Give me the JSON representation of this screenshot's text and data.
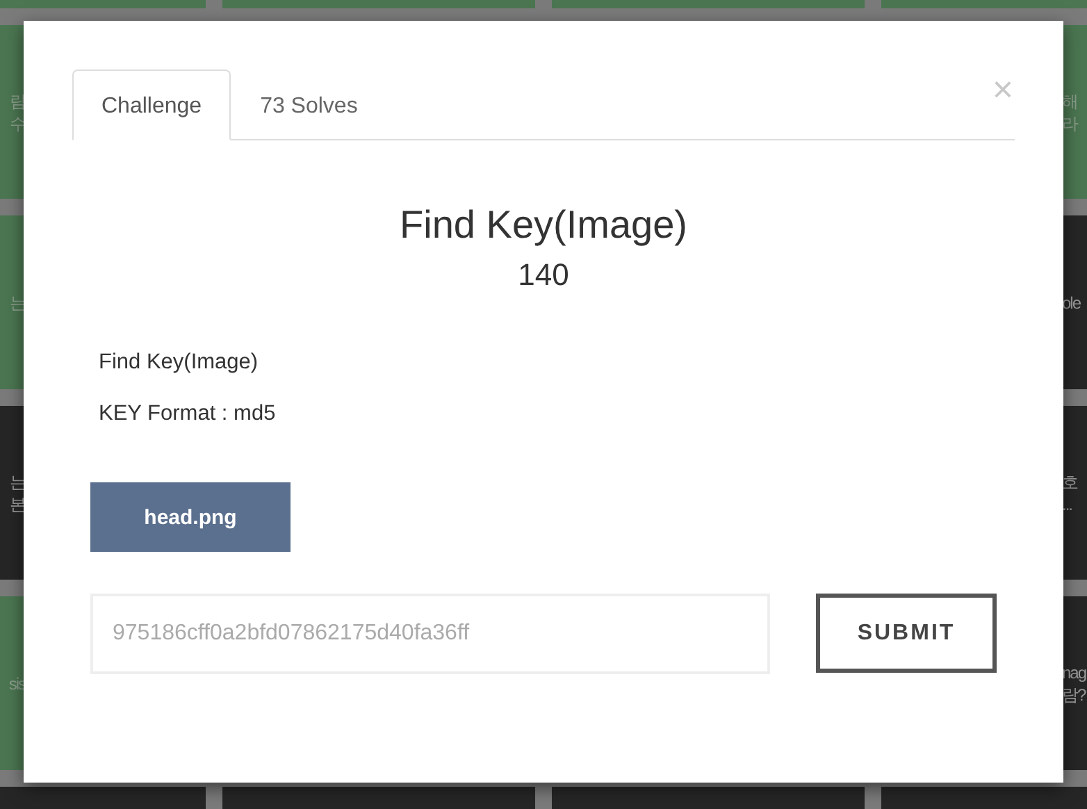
{
  "background_tiles": [
    {
      "tiles": [
        {
          "solved": true
        },
        {
          "solved": true
        },
        {
          "solved": true
        },
        {
          "solved": true
        }
      ]
    },
    {
      "tiles": [
        {
          "solved": true,
          "lines": [
            "림",
            "수"
          ]
        },
        {
          "solved": true,
          "lines": [
            "해",
            "라"
          ]
        }
      ]
    },
    {
      "tiles": [
        {
          "solved": true,
          "lines": [
            "는"
          ]
        },
        {
          "solved": false,
          "lines": [
            "ole"
          ]
        }
      ]
    },
    {
      "tiles": [
        {
          "solved": false,
          "lines": [
            "는",
            "본"
          ]
        },
        {
          "solved": false,
          "lines": [
            "호",
            "..."
          ]
        }
      ]
    },
    {
      "tiles": [
        {
          "solved": true,
          "lines": [
            "sis"
          ]
        },
        {
          "solved": false,
          "lines": [
            "nag",
            "람?"
          ]
        }
      ]
    },
    {
      "tiles": [
        {
          "solved": false
        },
        {
          "solved": false
        },
        {
          "solved": false
        },
        {
          "solved": false
        }
      ]
    }
  ],
  "modal": {
    "close": "×",
    "tabs": [
      {
        "label": "Challenge",
        "selected": true
      },
      {
        "label": "73 Solves",
        "selected": false
      }
    ],
    "title": "Find Key(Image)",
    "points": "140",
    "description": [
      "Find Key(Image)",
      "KEY Format : md5"
    ],
    "files": [
      "head.png"
    ],
    "answer": {
      "value": "975186cff0a2bfd07862175d40fa36ff"
    },
    "submit": "SUBMIT"
  }
}
